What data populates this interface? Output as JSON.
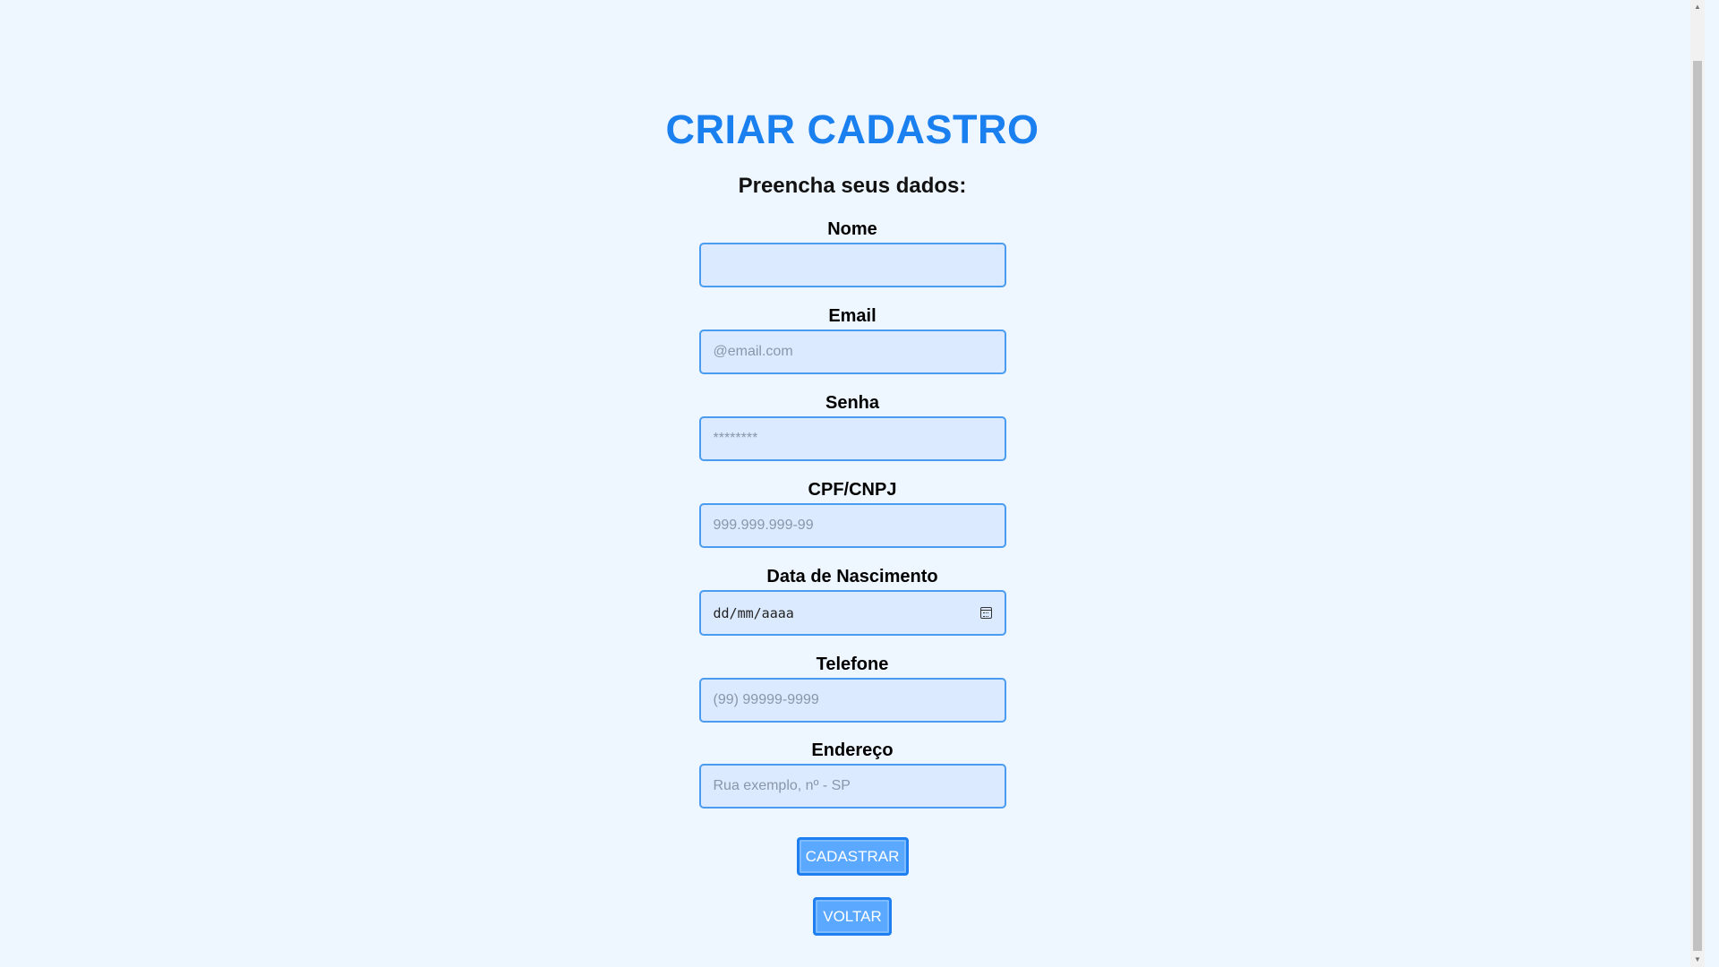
{
  "page": {
    "title": "CRIAR CADASTRO",
    "subtitle": "Preencha seus dados:"
  },
  "fields": {
    "nome": {
      "label": "Nome",
      "placeholder": ""
    },
    "email": {
      "label": "Email",
      "placeholder": "@email.com"
    },
    "senha": {
      "label": "Senha",
      "placeholder": "********"
    },
    "cpf": {
      "label": "CPF/CNPJ",
      "placeholder": "999.999.999-99"
    },
    "nascimento": {
      "label": "Data de Nascimento",
      "value": "dd/mm/aaaa",
      "icon": "calendar-icon"
    },
    "telefone": {
      "label": "Telefone",
      "placeholder": "(99) 99999-9999"
    },
    "endereco": {
      "label": "Endereço",
      "placeholder": "Rua exemplo, nº - SP"
    }
  },
  "buttons": {
    "cadastrar": "CADASTRAR",
    "voltar": "VOLTAR"
  },
  "colors": {
    "background": "#eef6ff",
    "title": "#1a7fef",
    "input_bg": "#dbeaff",
    "input_border": "#4a9cf0",
    "button_bg": "#5aa8ff",
    "button_border": "#1f7ff0"
  }
}
